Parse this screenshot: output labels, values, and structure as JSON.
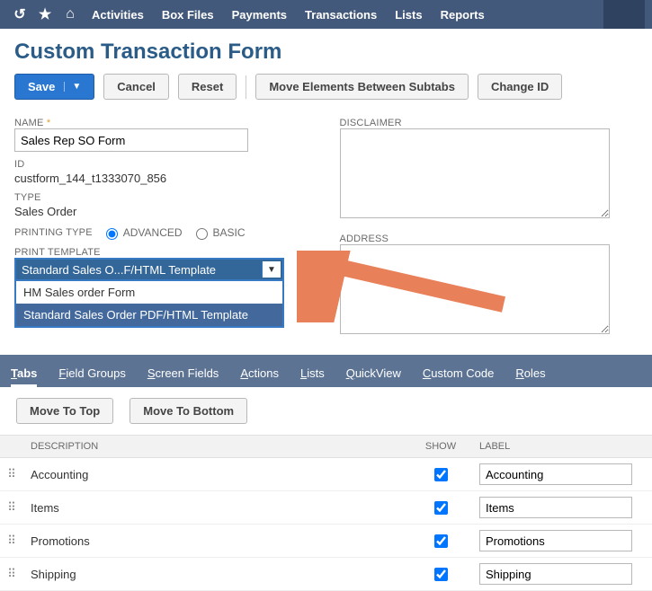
{
  "topbar": {
    "items": [
      "Activities",
      "Box Files",
      "Payments",
      "Transactions",
      "Lists",
      "Reports"
    ]
  },
  "page_title": "Custom Transaction Form",
  "toolbar": {
    "save": "Save",
    "cancel": "Cancel",
    "reset": "Reset",
    "move_elements": "Move Elements Between Subtabs",
    "change_id": "Change ID"
  },
  "left": {
    "name_label": "NAME",
    "name_value": "Sales Rep SO Form",
    "id_label": "ID",
    "id_value": "custform_144_t1333070_856",
    "type_label": "TYPE",
    "type_value": "Sales Order",
    "printing_type_label": "PRINTING TYPE",
    "printing_opts": {
      "advanced": "ADVANCED",
      "basic": "BASIC"
    },
    "print_template_label": "PRINT TEMPLATE",
    "print_template_selected": "Standard Sales O...F/HTML Template",
    "print_template_options": [
      "HM Sales order Form",
      "Standard Sales Order PDF/HTML Template"
    ]
  },
  "right": {
    "disclaimer_label": "DISCLAIMER",
    "disclaimer_value": "",
    "address_label": "ADDRESS",
    "address_value": ""
  },
  "subtabs": [
    "Tabs",
    "Field Groups",
    "Screen Fields",
    "Actions",
    "Lists",
    "QuickView",
    "Custom Code",
    "Roles"
  ],
  "subtoolbar": {
    "move_top": "Move To Top",
    "move_bottom": "Move To Bottom"
  },
  "grid": {
    "headers": {
      "description": "DESCRIPTION",
      "show": "SHOW",
      "label": "LABEL"
    },
    "rows": [
      {
        "description": "Accounting",
        "show": true,
        "label": "Accounting"
      },
      {
        "description": "Items",
        "show": true,
        "label": "Items"
      },
      {
        "description": "Promotions",
        "show": true,
        "label": "Promotions"
      },
      {
        "description": "Shipping",
        "show": true,
        "label": "Shipping"
      }
    ]
  }
}
